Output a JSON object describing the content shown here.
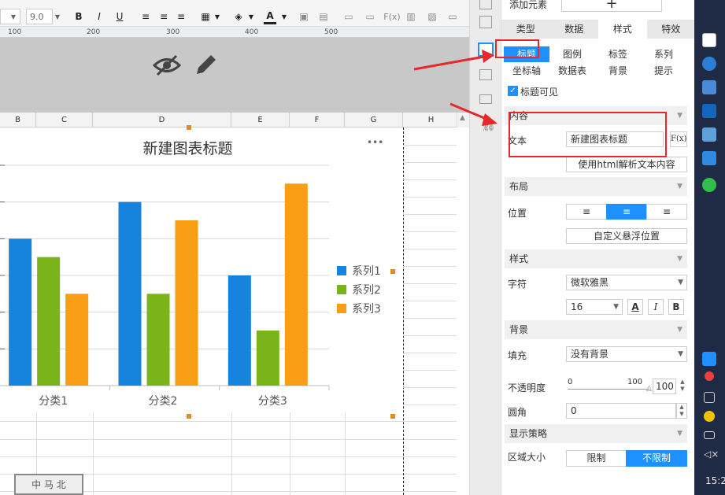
{
  "toolbar": {
    "font_size": "9.0",
    "bold": "B",
    "italic": "I",
    "underline": "U",
    "font_color_glyph": "A",
    "formula_glyph": "F(x)"
  },
  "ruler": {
    "ticks": [
      "100",
      "200",
      "300",
      "400",
      "500"
    ]
  },
  "sheet": {
    "columns": [
      "B",
      "C",
      "D",
      "E",
      "F",
      "G",
      "H"
    ]
  },
  "chart_data": {
    "type": "bar",
    "title": "新建图表标题",
    "categories": [
      "分类1",
      "分类2",
      "分类3"
    ],
    "series": [
      {
        "name": "系列1",
        "values": [
          200,
          250,
          150
        ],
        "color": "#1684dc"
      },
      {
        "name": "系列2",
        "values": [
          175,
          125,
          75
        ],
        "color": "#7bb31a"
      },
      {
        "name": "系列3",
        "values": [
          125,
          225,
          275
        ],
        "color": "#f99e15"
      }
    ],
    "ylim": [
      0,
      300
    ],
    "grid": true,
    "legend": "right",
    "more_glyph": "•••"
  },
  "panel": {
    "add_element_label": "添加元素",
    "add_glyph": "+",
    "tabs": [
      "类型",
      "数据",
      "样式",
      "特效"
    ],
    "active_tab": "样式",
    "subtabs_row1": [
      "标题",
      "图例",
      "标签",
      "系列"
    ],
    "subtabs_row2": [
      "坐标轴",
      "数据表",
      "背景",
      "提示"
    ],
    "active_subtab": "标题",
    "title_visible_label": "标题可见",
    "content_section": "内容",
    "text_label": "文本",
    "text_value": "新建图表标题",
    "fx_label": "F(x)",
    "html_parse_button": "使用html解析文本内容",
    "layout_section": "布局",
    "position_label": "位置",
    "custom_float_button": "自定义悬浮位置",
    "style_section": "样式",
    "font_label": "字符",
    "font_value": "微软雅黑",
    "font_size_value": "16",
    "font_style_buttons": [
      "A",
      "I",
      "B"
    ],
    "background_section": "背景",
    "fill_label": "填充",
    "fill_value": "没有背景",
    "opacity_label": "不透明度",
    "opacity_min": "0",
    "opacity_max": "100",
    "opacity_value": "100",
    "opacity_level": 1.0,
    "radius_label": "圆角",
    "radius_value": "0",
    "display_section": "显示策略",
    "area_size_label": "区域大小",
    "area_options": [
      "限制",
      "不限制"
    ],
    "area_selected": "不限制"
  },
  "taskbar": {
    "time": "15:2"
  },
  "bottom_stamp": "中 马 北",
  "colors": {
    "accent": "#1e90ff",
    "annotation": "#e6282b"
  }
}
